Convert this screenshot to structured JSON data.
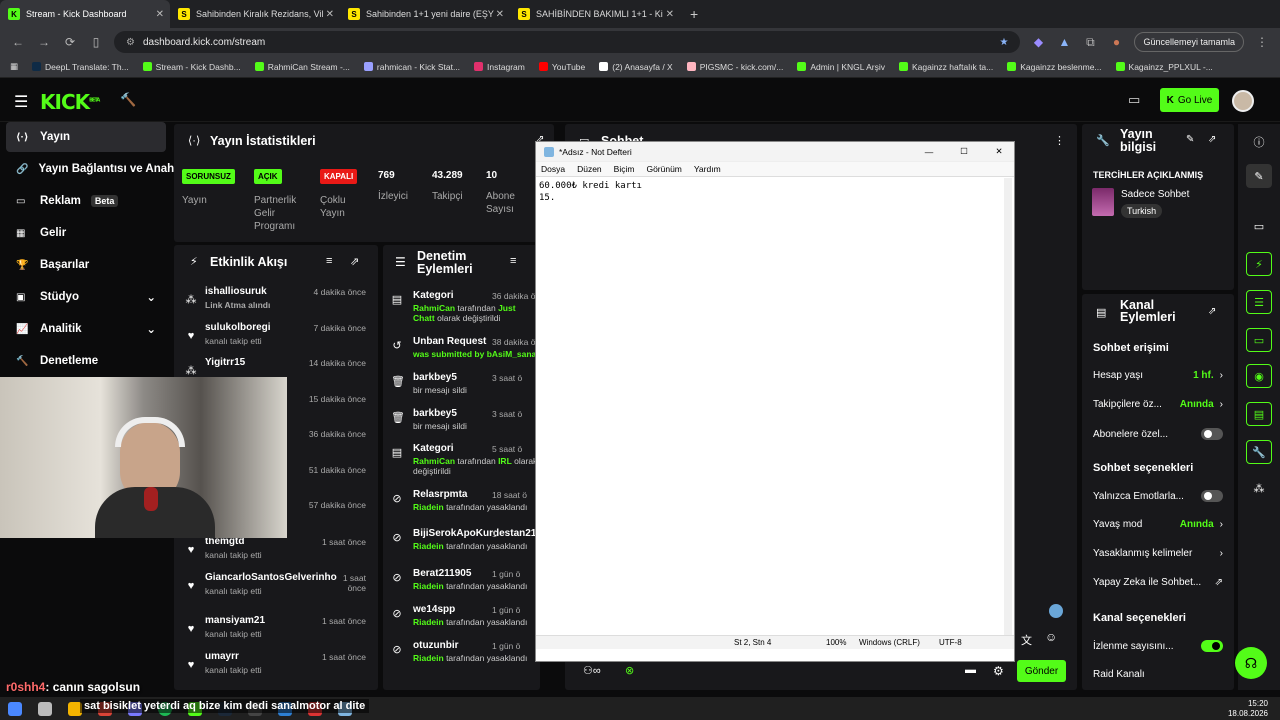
{
  "browser": {
    "tabs": [
      {
        "label": "Stream - Kick Dashboard",
        "favicon": "K",
        "color": "#53fc18",
        "active": true
      },
      {
        "label": "Sahibinden Kiralık Rezidans, Vil",
        "favicon": "S",
        "color": "#ffe800"
      },
      {
        "label": "Sahibinden 1+1 yeni daire (EŞY",
        "favicon": "S",
        "color": "#ffe800"
      },
      {
        "label": "SAHİBİNDEN BAKIMLI 1+1 - Ki",
        "favicon": "S",
        "color": "#ffe800"
      }
    ],
    "url": "dashboard.kick.com/stream",
    "update_label": "Güncellemeyi tamamla",
    "bookmarks": [
      {
        "label": "DeepL Translate: Th...",
        "color": "#0f2b46"
      },
      {
        "label": "Stream - Kick Dashb...",
        "color": "#53fc18"
      },
      {
        "label": "RahmiCan Stream -...",
        "color": "#53fc18"
      },
      {
        "label": "rahmican - Kick Stat...",
        "color": "#9aa0ff"
      },
      {
        "label": "Instagram",
        "color": "#e1306c"
      },
      {
        "label": "YouTube",
        "color": "#ff0000"
      },
      {
        "label": "(2) Anasayfa / X",
        "color": "#ffffff"
      },
      {
        "label": "PIGSMC - kick.com/...",
        "color": "#ffb6c1"
      },
      {
        "label": "Admin | KNGL Arşiv",
        "color": "#53fc18"
      },
      {
        "label": "Kagainzz haftalık ta...",
        "color": "#53fc18"
      },
      {
        "label": "Kagainzz beslenme...",
        "color": "#53fc18"
      },
      {
        "label": "Kagainzz_PPLXUL -...",
        "color": "#53fc18"
      }
    ]
  },
  "header": {
    "logo": "KICK",
    "logo_sup": "BETA",
    "go_live": "Go Live"
  },
  "sidebar": {
    "items": [
      {
        "label": "Yayın",
        "icon": "broadcast-icon"
      },
      {
        "label": "Yayın Bağlantısı ve Anahtar",
        "icon": "link-icon"
      },
      {
        "label": "Reklam",
        "badge": "Beta",
        "icon": "ad-icon"
      },
      {
        "label": "Gelir",
        "icon": "revenue-icon"
      },
      {
        "label": "Başarılar",
        "icon": "trophy-icon"
      },
      {
        "label": "Stüdyo",
        "icon": "studio-icon"
      },
      {
        "label": "Analitik",
        "icon": "analytics-icon"
      },
      {
        "label": "Denetleme",
        "icon": "moderation-icon"
      }
    ]
  },
  "stats": {
    "title": "Yayın İstatistikleri",
    "items": [
      {
        "value": "SORUNSUZ",
        "label": "Yayın",
        "tag": "green"
      },
      {
        "value": "AÇIK",
        "label": "Partnerlik Gelir Programı",
        "tag": "green"
      },
      {
        "value": "KAPALI",
        "label": "Çoklu Yayın",
        "tag": "red"
      },
      {
        "value": "769",
        "label": "İzleyici"
      },
      {
        "value": "43.289",
        "label": "Takipçi"
      },
      {
        "value": "10",
        "label": "Abone Sayısı"
      }
    ]
  },
  "activity": {
    "title": "Etkinlik Akışı",
    "items": [
      {
        "name": "ishalliosuruk",
        "sub": "Link Atma alındı",
        "sub_green": true,
        "time": "4 dakika önce",
        "icon": "redeem-icon"
      },
      {
        "name": "sulukolboregi",
        "sub": "kanalı takip etti",
        "time": "7 dakika önce",
        "icon": "heart-icon"
      },
      {
        "name": "Yigitrr15",
        "sub": "",
        "time": "14 dakika önce",
        "icon": "redeem-icon"
      },
      {
        "name": "",
        "sub": "",
        "time": "15 dakika önce",
        "icon": ""
      },
      {
        "name": "",
        "sub": "",
        "time": "36 dakika önce",
        "icon": ""
      },
      {
        "name": "",
        "sub": "",
        "time": "51 dakika önce",
        "icon": ""
      },
      {
        "name": "",
        "sub": "",
        "time": "57 dakika önce",
        "icon": ""
      },
      {
        "name": "themgtd",
        "sub": "kanalı takip etti",
        "time": "1 saat önce",
        "icon": "heart-icon"
      },
      {
        "name": "GiancarloSantosGelverinho",
        "sub": "kanalı takip etti",
        "time": "1 saat önce",
        "icon": "heart-icon"
      },
      {
        "name": "mansiyam21",
        "sub": "kanalı takip etti",
        "time": "1 saat önce",
        "icon": "heart-icon"
      },
      {
        "name": "umayrr",
        "sub": "kanalı takip etti",
        "time": "1 saat önce",
        "icon": "heart-icon"
      }
    ]
  },
  "moderation": {
    "title": "Denetim Eylemleri",
    "items": [
      {
        "title": "Kategori",
        "sub1": "RahmiCan",
        "sub2": " tarafından ",
        "sub3": "Just Chatt",
        "sub4": "olarak değiştirildi",
        "time": "36 dakika ö",
        "icon": "category-icon"
      },
      {
        "title": "Unban Request",
        "sub1": "was submitted by ",
        "sub2": "bAsiM_sana",
        "time": "38 dakika ö",
        "icon": "unban-icon"
      },
      {
        "title": "barkbey5",
        "sub1": "bir mesajı sildi",
        "time": "3 saat ö",
        "icon": "trash-icon"
      },
      {
        "title": "barkbey5",
        "sub1": "bir mesajı sildi",
        "time": "3 saat ö",
        "icon": "trash-icon"
      },
      {
        "title": "Kategori",
        "sub1": "RahmiCan",
        "sub2": " tarafından ",
        "sub3": "IRL",
        "sub4": "olarak değiştirildi",
        "time": "5 saat ö",
        "icon": "category-icon"
      },
      {
        "title": "Relasrpmta",
        "sub1": "Riadein",
        "sub2": " tarafından yasaklandı",
        "time": "18 saat ö",
        "icon": "ban-icon"
      },
      {
        "title": "BijiSerokApoKurdestan21",
        "sub1": "Riadein",
        "sub2": " tarafından yasaklandı",
        "time": "1",
        "icon": "ban-icon"
      },
      {
        "title": "Berat211905",
        "sub1": "Riadein",
        "sub2": " tarafından yasaklandı",
        "time": "1 gün ö",
        "icon": "ban-icon"
      },
      {
        "title": "we14spp",
        "sub1": "Riadein",
        "sub2": " tarafından yasaklandı",
        "time": "1 gün ö",
        "icon": "ban-icon"
      },
      {
        "title": "otuzunbir",
        "sub1": "Riadein",
        "sub2": " tarafından yasaklandı",
        "time": "1 gün ö",
        "icon": "ban-icon"
      }
    ]
  },
  "chat": {
    "title": "Sohbet",
    "send": "Gönder"
  },
  "notepad": {
    "title": "*Adsız - Not Defteri",
    "menu": [
      "Dosya",
      "Düzen",
      "Biçim",
      "Görünüm",
      "Yardım"
    ],
    "content": "60.000₺ kredi kartı\n15.",
    "status": {
      "pos": "St 2, Stn 4",
      "zoom": "100%",
      "eol": "Windows (CRLF)",
      "enc": "UTF-8"
    }
  },
  "stream_info": {
    "title": "Yayın bilgisi",
    "heading": "TERCİHLER AÇIKLANMIŞ",
    "category": "Sadece Sohbet",
    "tag": "Turkish"
  },
  "channel_actions": {
    "title": "Kanal Eylemleri",
    "chat_access": "Sohbet erişimi",
    "rows1": [
      {
        "label": "Hesap yaşı",
        "value": "1 hf.",
        "type": "chevron"
      },
      {
        "label": "Takipçilere öz...",
        "value": "Anında",
        "type": "chevron"
      },
      {
        "label": "Abonelere özel...",
        "type": "toggle",
        "on": false
      }
    ],
    "chat_options": "Sohbet seçenekleri",
    "rows2": [
      {
        "label": "Yalnızca Emotlarla...",
        "type": "toggle",
        "on": false
      },
      {
        "label": "Yavaş mod",
        "value": "Anında",
        "type": "chevron"
      },
      {
        "label": "Yasaklanmış kelimeler",
        "type": "chevron"
      },
      {
        "label": "Yapay Zeka ile Sohbet...",
        "type": "external"
      }
    ],
    "channel_options": "Kanal seçenekleri",
    "rows3": [
      {
        "label": "İzlenme sayısını...",
        "type": "toggle",
        "on": true
      },
      {
        "label": "Raid Kanalı",
        "type": "none"
      }
    ]
  },
  "overlay": {
    "chat_user": "r0shh4",
    "chat_msg": ": canın sagolsun",
    "ticker": "sat bisiklet yeterdi aq bize kim dedi sanalmotor al dite"
  },
  "taskbar": {
    "time": "15:20",
    "date": "18.08.2026"
  }
}
